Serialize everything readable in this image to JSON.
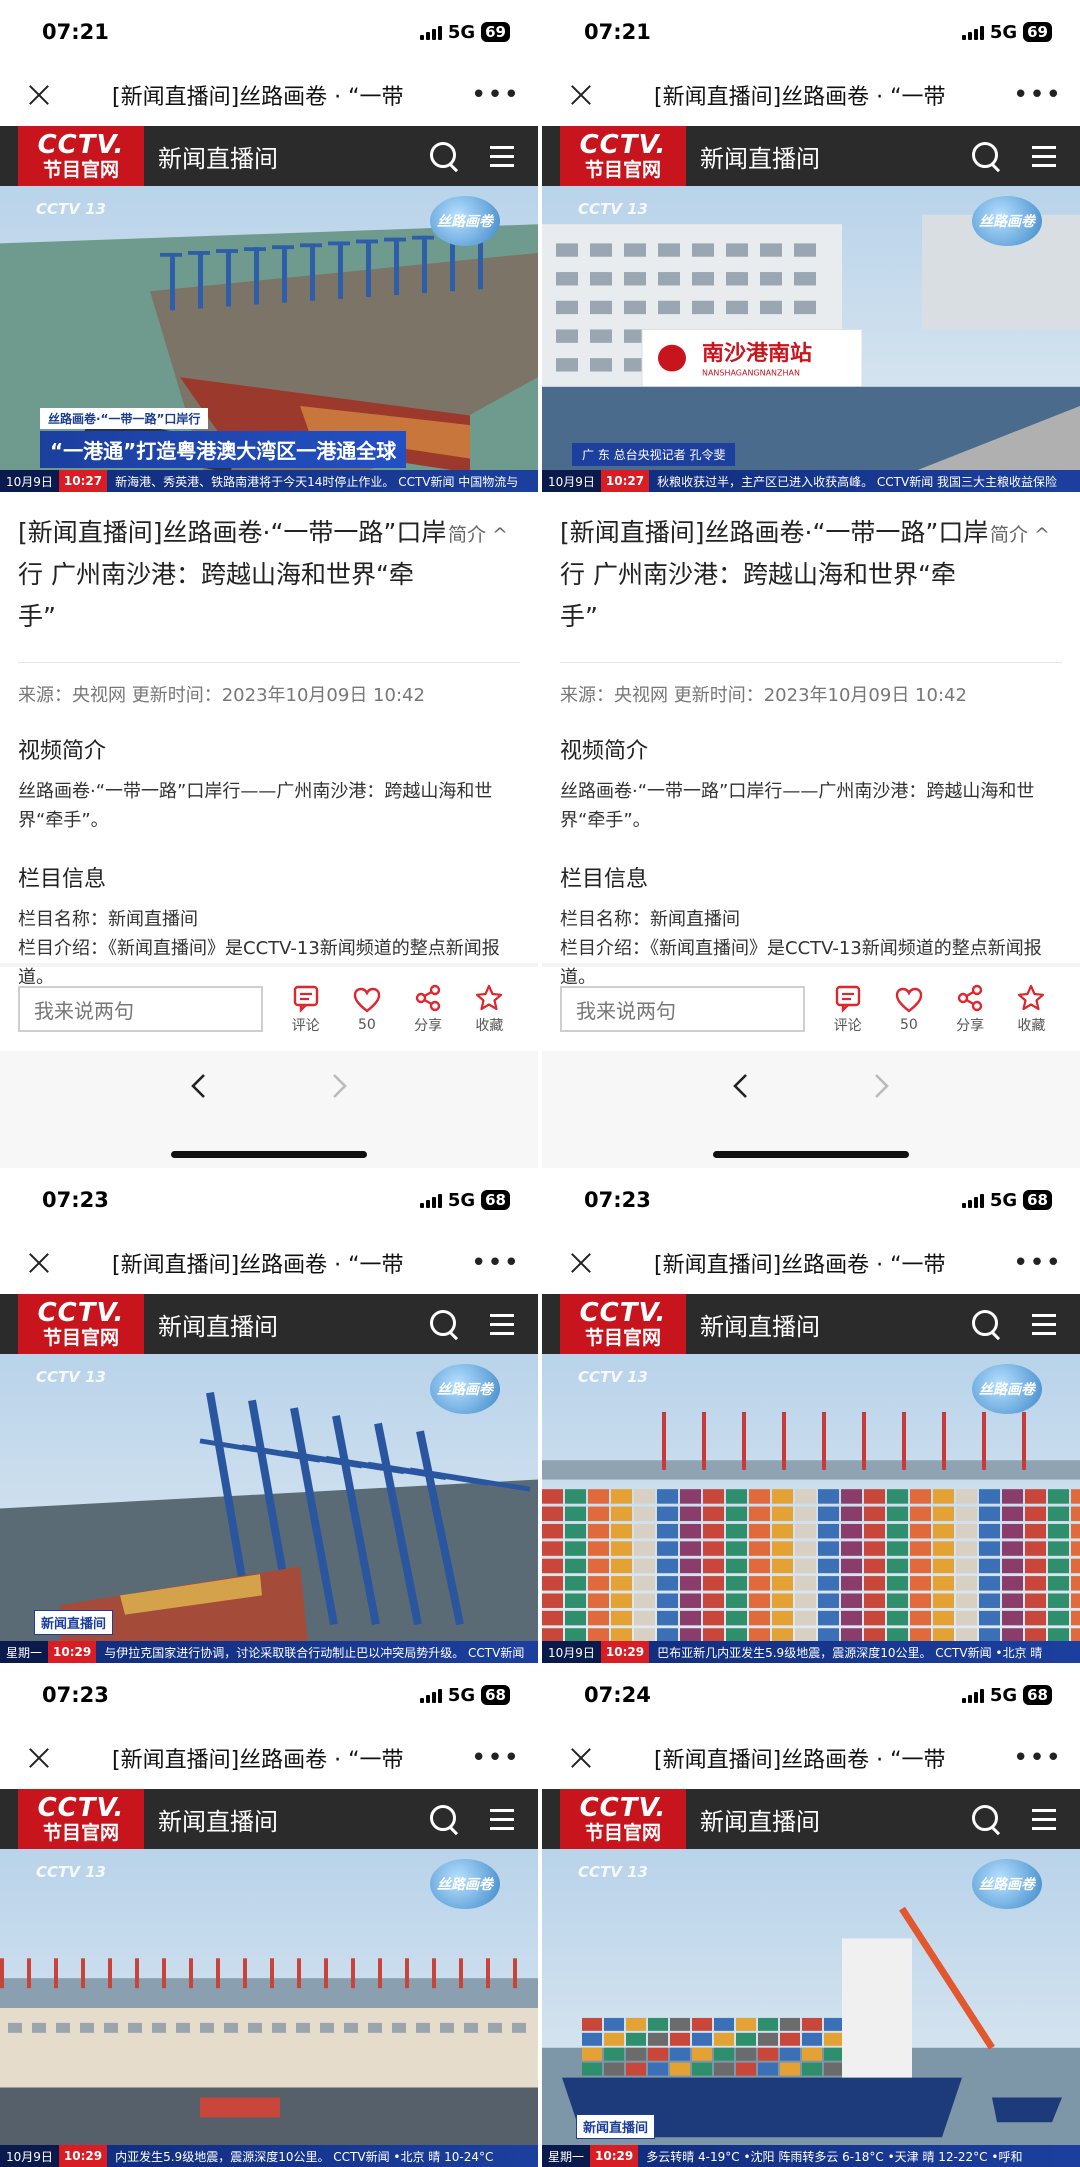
{
  "panels": [
    {
      "time": "07:21",
      "network": "5G",
      "battery": "69",
      "title": "[新闻直播间]丝路画卷 · “一带",
      "channel": "新闻直播间",
      "logo_line1": "CCTV.",
      "logo_line2": "节目官网",
      "video": {
        "scene": "port-aerial",
        "badge": "丝路画卷",
        "channel_logo": "CCTV 13",
        "caption_sub": "丝路画卷·“一带一路”口岸行",
        "caption_main": "“一港通”打造粤港澳大湾区一港通全球",
        "reporter": "",
        "news_box": "新闻直播间",
        "ticker_date": "10月9日",
        "ticker_time": "10:27",
        "ticker_text": "新海港、秀英港、铁路南港将于今天14时停止作业。  CCTV新闻  中国物流与"
      }
    },
    {
      "time": "07:21",
      "network": "5G",
      "battery": "69",
      "title": "[新闻直播间]丝路画卷 · “一带",
      "channel": "新闻直播间",
      "logo_line1": "CCTV.",
      "logo_line2": "节目官网",
      "video": {
        "scene": "station",
        "badge": "丝路画卷",
        "channel_logo": "CCTV 13",
        "station_sign": "南沙港南站",
        "station_sign_en": "NANSHAGANGNANZHAN",
        "caption_sub": "",
        "caption_main": "",
        "reporter": "广 东   总台央视记者  孔令斐",
        "news_box": "",
        "ticker_date": "10月9日",
        "ticker_time": "10:27",
        "ticker_text": "秋粮收获过半，主产区已进入收获高峰。  CCTV新闻  我国三大主粮收益保险"
      }
    },
    {
      "time": "07:23",
      "network": "5G",
      "battery": "68",
      "title": "[新闻直播间]丝路画卷 · “一带",
      "channel": "新闻直播间",
      "logo_line1": "CCTV.",
      "logo_line2": "节目官网",
      "video": {
        "scene": "cranes",
        "badge": "丝路画卷",
        "channel_logo": "CCTV 13",
        "news_box": "新闻直播间",
        "ticker_date": "星期一",
        "ticker_time": "10:29",
        "ticker_text": "与伊拉克国家进行协调，讨论采取联合行动制止巴以冲突局势升级。  CCTV新闻"
      }
    },
    {
      "time": "07:23",
      "network": "5G",
      "battery": "68",
      "title": "[新闻直播间]丝路画卷 · “一带",
      "channel": "新闻直播间",
      "logo_line1": "CCTV.",
      "logo_line2": "节目官网",
      "video": {
        "scene": "containers",
        "badge": "丝路画卷",
        "channel_logo": "CCTV 13",
        "news_box": "",
        "ticker_date": "10月9日",
        "ticker_time": "10:29",
        "ticker_text": "巴布亚新几内亚发生5.9级地震，震源深度10公里。  CCTV新闻  •北京 晴"
      }
    },
    {
      "time": "07:23",
      "network": "5G",
      "battery": "68",
      "title": "[新闻直播间]丝路画卷 · “一带",
      "channel": "新闻直播间",
      "logo_line1": "CCTV.",
      "logo_line2": "节目官网",
      "video": {
        "scene": "terminal",
        "badge": "丝路画卷",
        "channel_logo": "CCTV 13",
        "news_box": "",
        "ticker_date": "10月9日",
        "ticker_time": "10:29",
        "ticker_text": "内亚发生5.9级地震，震源深度10公里。  CCTV新闻  •北京 晴 10-24°C"
      }
    },
    {
      "time": "07:24",
      "network": "5G",
      "battery": "68",
      "title": "[新闻直播间]丝路画卷 · “一带",
      "channel": "新闻直播间",
      "logo_line1": "CCTV.",
      "logo_line2": "节目官网",
      "video": {
        "scene": "ship",
        "badge": "丝路画卷",
        "channel_logo": "CCTV 13",
        "news_box": "新闻直播间",
        "ticker_date": "星期一",
        "ticker_time": "10:29",
        "ticker_text": "多云转晴 4-19°C •沈阳 阵雨转多云 6-18°C •天津 晴 12-22°C •呼和"
      }
    }
  ],
  "article": {
    "title_line1": "[新闻直播间]丝路画卷·“一带一路”口岸",
    "title_line2": "行 广州南沙港：跨越山海和世界“牵手”",
    "intro_toggle": "简介 ^",
    "meta": "来源：央视网  更新时间：2023年10月09日 10:42",
    "summary_heading": "视频简介",
    "summary_text": "丝路画卷·“一带一路”口岸行——广州南沙港：跨越山海和世界“牵手”。",
    "column_heading": "栏目信息",
    "column_name": "栏目名称：新闻直播间",
    "column_intro": "栏目介绍：《新闻直播间》是CCTV-13新闻频道的整点新闻报道。"
  },
  "actions": {
    "comment_placeholder": "我来说两句",
    "comment_label": "评论",
    "like_count": "50",
    "share_label": "分享",
    "favorite_label": "收藏"
  },
  "colors": {
    "brand_red": "#c8151d",
    "header_dark": "#2b2b2b",
    "like_red": "#e0262d"
  }
}
